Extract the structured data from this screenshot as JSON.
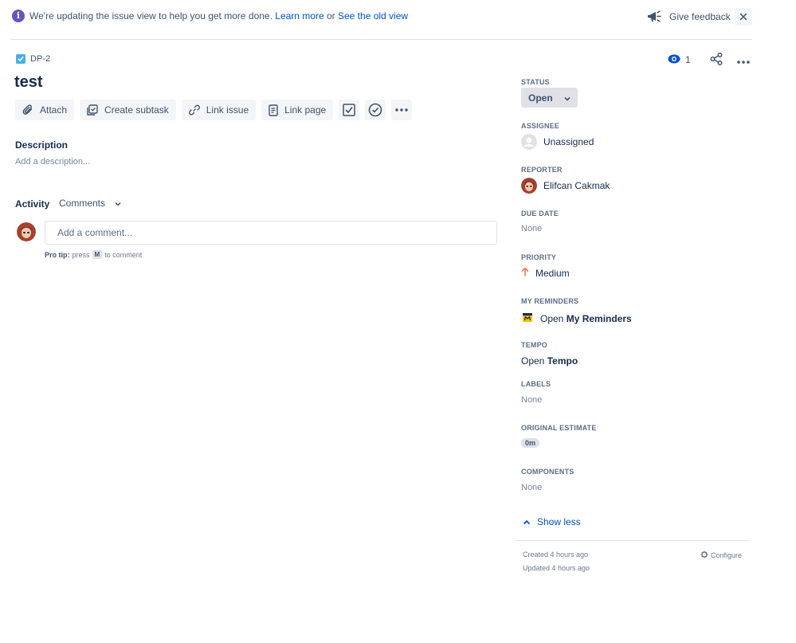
{
  "banner": {
    "icon": "info-icon",
    "message": "We're updating the issue view to help you get more done.",
    "learn_more": "Learn more",
    "connector": "or",
    "old_view": "See the old view",
    "feedback_label": "Give feedback",
    "close_icon": "close-icon"
  },
  "issue": {
    "key": "DP-2",
    "title": "test",
    "watch_count": "1"
  },
  "toolbar": {
    "attach": "Attach",
    "create_subtask": "Create subtask",
    "link_issue": "Link issue",
    "link_page": "Link page"
  },
  "description": {
    "label": "Description",
    "placeholder": "Add a description..."
  },
  "activity": {
    "label": "Activity",
    "filter": "Comments",
    "comment_placeholder": "Add a comment...",
    "pro_tip_label": "Pro tip:",
    "pro_tip_press": "press",
    "pro_tip_key": "M",
    "pro_tip_suffix": "to comment"
  },
  "fields": {
    "status_label": "STATUS",
    "status_value": "Open",
    "assignee_label": "ASSIGNEE",
    "assignee_value": "Unassigned",
    "reporter_label": "REPORTER",
    "reporter_value": "Elifcan Cakmak",
    "due_date_label": "DUE DATE",
    "due_date_value": "None",
    "priority_label": "PRIORITY",
    "priority_value": "Medium",
    "reminders_label": "MY REMINDERS",
    "reminders_open": "Open",
    "reminders_name": "My Reminders",
    "tempo_label": "TEMPO",
    "tempo_open": "Open",
    "tempo_name": "Tempo",
    "labels_label": "LABELS",
    "labels_value": "None",
    "estimate_label": "ORIGINAL ESTIMATE",
    "estimate_value": "0m",
    "components_label": "COMPONENTS",
    "components_value": "None"
  },
  "panel": {
    "show_less": "Show less",
    "created": "Created 4 hours ago",
    "updated": "Updated 4 hours ago",
    "configure": "Configure"
  },
  "colors": {
    "accent": "#0052cc",
    "info": "#6554c0",
    "priority_medium": "#ff7452"
  }
}
